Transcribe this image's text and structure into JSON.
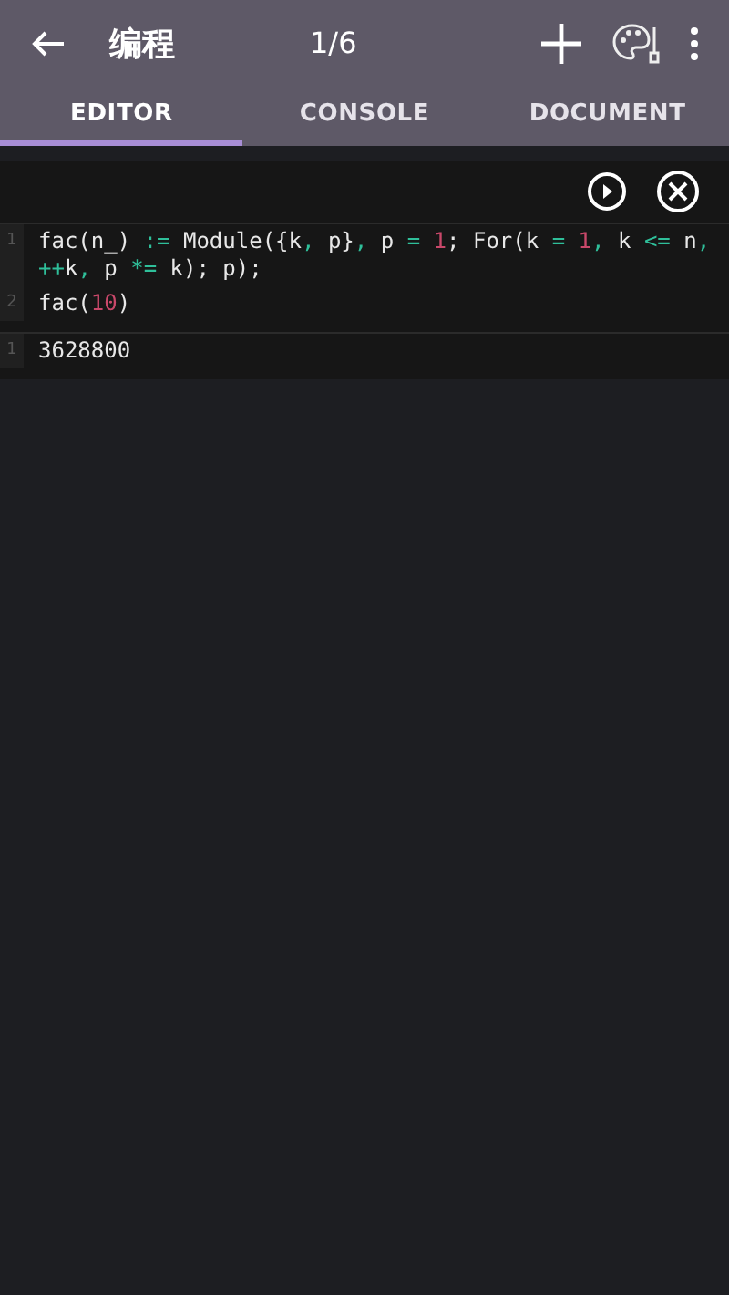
{
  "app_bar": {
    "title": "编程",
    "page_counter": "1/6"
  },
  "tabs": [
    {
      "label": "EDITOR",
      "selected": true
    },
    {
      "label": "CONSOLE",
      "selected": false
    },
    {
      "label": "DOCUMENT",
      "selected": false
    }
  ],
  "code_cell": {
    "input_lines": [
      {
        "number": "1",
        "tokens": [
          {
            "kind": "plain",
            "text": "fac(n_) "
          },
          {
            "kind": "operator",
            "text": ":="
          },
          {
            "kind": "plain",
            "text": " Module({k"
          },
          {
            "kind": "operator",
            "text": ","
          },
          {
            "kind": "plain",
            "text": " p}"
          },
          {
            "kind": "operator",
            "text": ","
          },
          {
            "kind": "plain",
            "text": " p "
          },
          {
            "kind": "operator",
            "text": "="
          },
          {
            "kind": "number",
            "text": " 1"
          },
          {
            "kind": "plain",
            "text": "; For(k "
          },
          {
            "kind": "operator",
            "text": "="
          },
          {
            "kind": "number",
            "text": " 1"
          },
          {
            "kind": "operator",
            "text": ","
          },
          {
            "kind": "plain",
            "text": " k "
          },
          {
            "kind": "operator",
            "text": "<="
          },
          {
            "kind": "plain",
            "text": " n"
          },
          {
            "kind": "operator",
            "text": ","
          },
          {
            "kind": "operator",
            "text": " ++"
          },
          {
            "kind": "plain",
            "text": "k"
          },
          {
            "kind": "operator",
            "text": ","
          },
          {
            "kind": "plain",
            "text": " p "
          },
          {
            "kind": "operator",
            "text": "*="
          },
          {
            "kind": "plain",
            "text": " k); p);"
          }
        ]
      },
      {
        "number": "2",
        "tokens": [
          {
            "kind": "plain",
            "text": "fac("
          },
          {
            "kind": "number",
            "text": "10"
          },
          {
            "kind": "plain",
            "text": ")"
          }
        ]
      }
    ],
    "output_lines": [
      {
        "number": "1",
        "text": "3628800"
      }
    ]
  }
}
